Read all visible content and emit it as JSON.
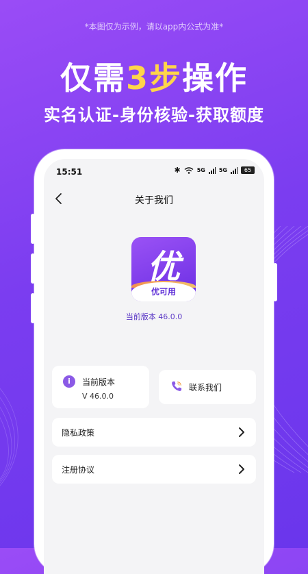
{
  "promo": {
    "disclaimer": "*本图仅为示例，请以app内公式为准*",
    "headline_before": "仅需",
    "headline_highlight": "3步",
    "headline_after": "操作",
    "subhead": "实名认证-身份核验-获取额度"
  },
  "status_bar": {
    "time": "15:51",
    "signal_1": "5G",
    "signal_2": "5G",
    "battery": "65"
  },
  "nav": {
    "title": "关于我们"
  },
  "app": {
    "logo_char": "优",
    "logo_name": "优可用",
    "version_caption": "当前版本 46.0.0"
  },
  "cards": {
    "version_label": "当前版本",
    "version_value": "V 46.0.0",
    "contact_label": "联系我们"
  },
  "rows": [
    {
      "label": "隐私政策"
    },
    {
      "label": "注册协议"
    }
  ],
  "colors": {
    "background_start": "#9a4cf6",
    "background_end": "#6a36ec",
    "highlight": "#ffd54a",
    "accent": "#8b5ae6"
  },
  "icons": {
    "back": "chevron-left-icon",
    "info": "info-icon",
    "phone": "phone-icon",
    "row_arrow": "chevron-right-icon"
  }
}
